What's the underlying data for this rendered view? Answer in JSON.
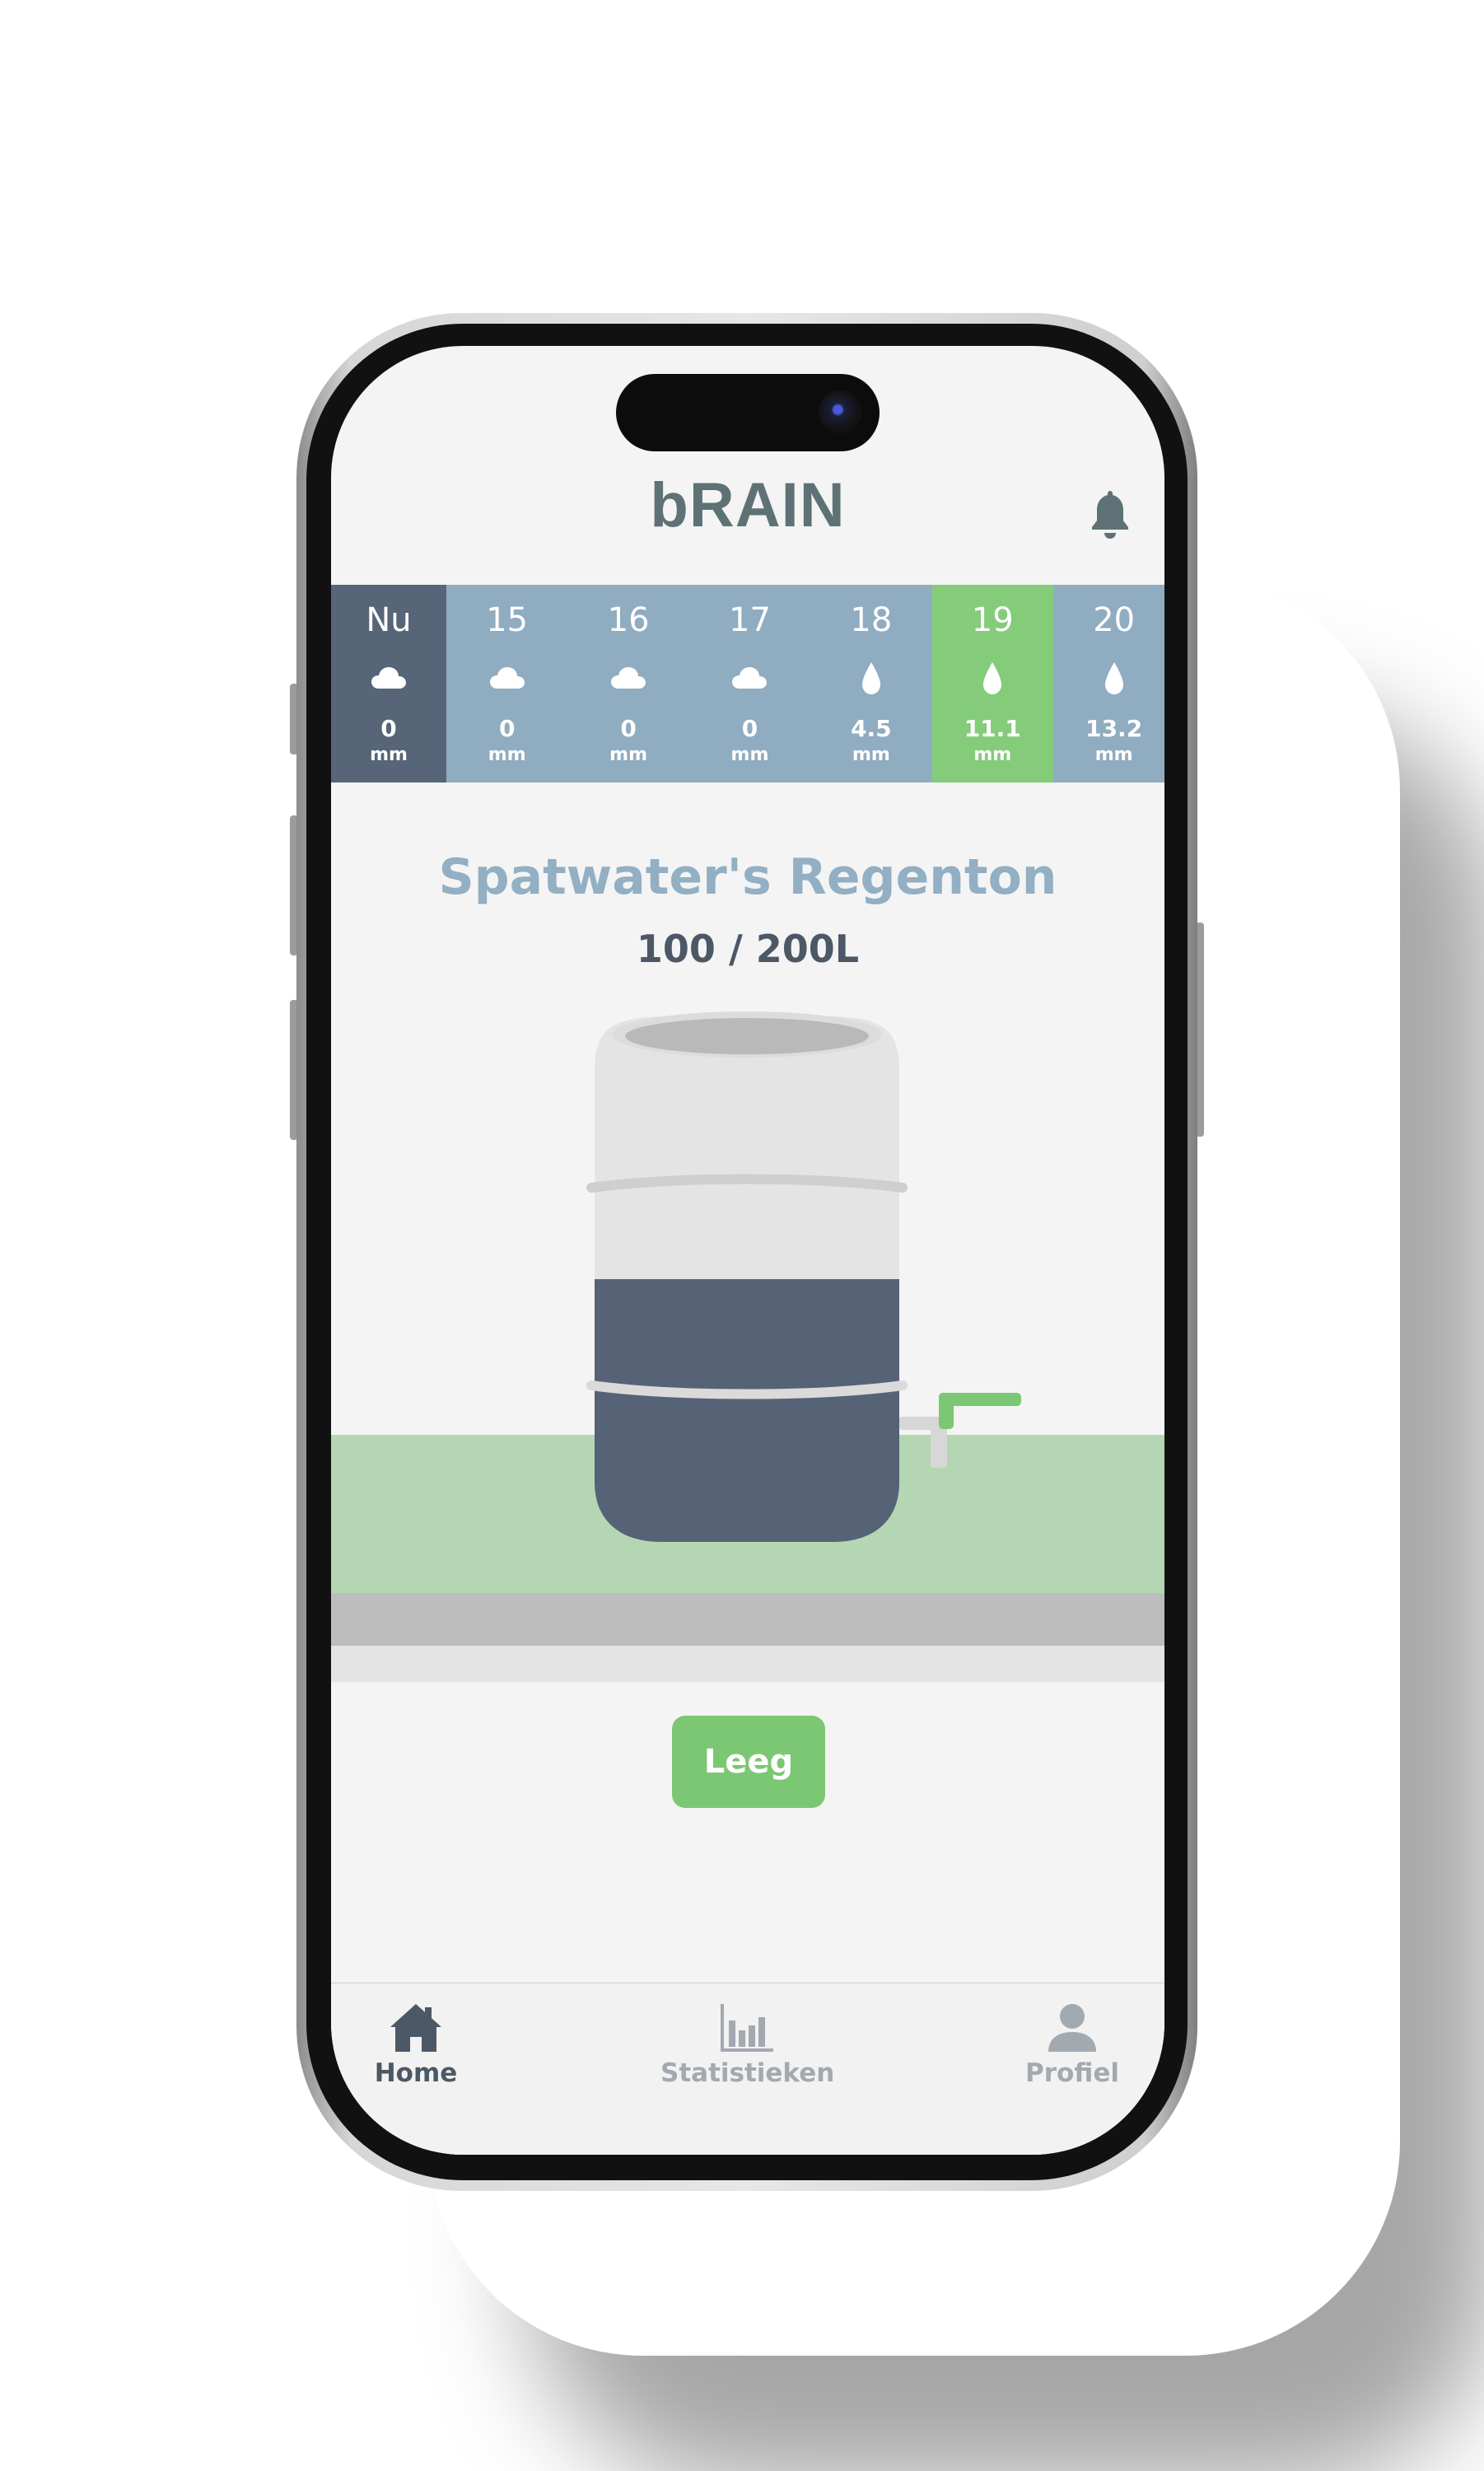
{
  "app": {
    "title": "bRAIN"
  },
  "colors": {
    "accent_green": "#84cc7a",
    "sky_blue": "#8facc1",
    "slate": "#566577",
    "title_blue": "#92afc3"
  },
  "forecast": {
    "days": [
      {
        "label": "Nu",
        "icon": "cloud-icon",
        "amount": "0",
        "unit": "mm"
      },
      {
        "label": "15",
        "icon": "cloud-icon",
        "amount": "0",
        "unit": "mm"
      },
      {
        "label": "16",
        "icon": "cloud-icon",
        "amount": "0",
        "unit": "mm"
      },
      {
        "label": "17",
        "icon": "cloud-icon",
        "amount": "0",
        "unit": "mm"
      },
      {
        "label": "18",
        "icon": "raindrop-icon",
        "amount": "4.5",
        "unit": "mm"
      },
      {
        "label": "19",
        "icon": "raindrop-icon",
        "amount": "11.1",
        "unit": "mm"
      },
      {
        "label": "20",
        "icon": "raindrop-icon",
        "amount": "13.2",
        "unit": "mm"
      }
    ]
  },
  "tank": {
    "name": "Spatwater's Regenton",
    "level_text": "100 / 200L",
    "fill_fraction": 0.5
  },
  "actions": {
    "empty_label": "Leeg"
  },
  "nav": {
    "home": "Home",
    "stats": "Statistieken",
    "profile": "Profiel"
  }
}
